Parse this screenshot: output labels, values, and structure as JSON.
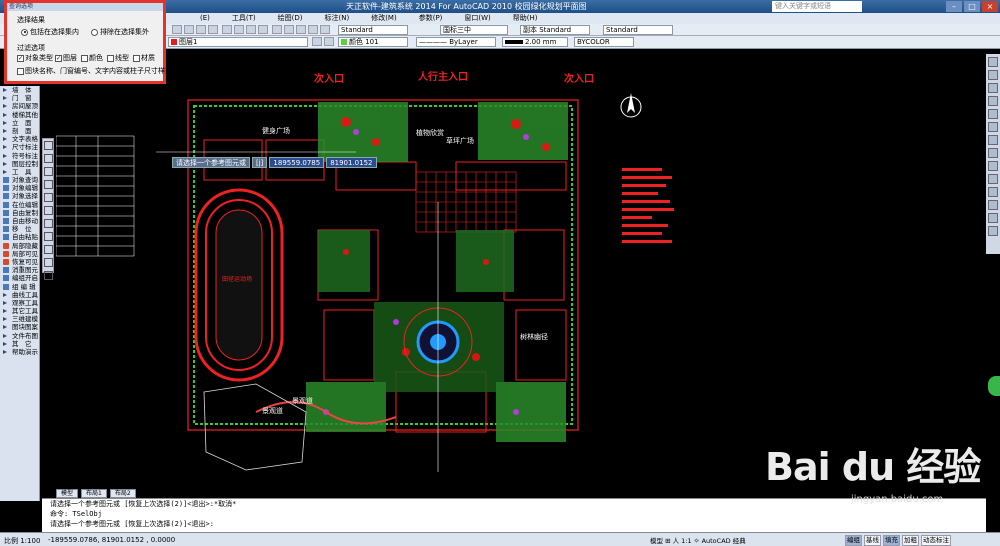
{
  "window": {
    "title": "天正软件-建筑系统 2014  For AutoCAD 2010      校园绿化规划平面图",
    "search_placeholder": "键入关键字或短语"
  },
  "menu": [
    "(E)",
    "工具(T)",
    "绘图(D)",
    "标注(N)",
    "修改(M)",
    "参数(P)",
    "窗口(W)",
    "帮助(H)"
  ],
  "toolbar": {
    "style1": "Standard",
    "style2": "国标三中",
    "style3": "副本 Standard",
    "style4": "Standard",
    "layer": "图层1",
    "color": "颜色 101",
    "linetype": "ByLayer",
    "lineweight": "2.00 mm",
    "plotstyle": "BYCOLOR"
  },
  "dialog": {
    "title": "查询选项",
    "group1": "选择结果",
    "radio_in": "包括在选择集内",
    "radio_out": "排除在选择集外",
    "group2": "过滤选项",
    "cb_objtype": "对象类型",
    "cb_layer": "图层",
    "cb_color": "颜色",
    "cb_linetype": "线型",
    "cb_material": "材质",
    "cb_block": "图块名称、门窗编号、文字内容或柱子尺寸样式"
  },
  "left_panel": [
    "墙　体",
    "门　窗",
    "房间屋顶",
    "楼梯其他",
    "立　面",
    "剖　面",
    "文字表格",
    "尺寸标注",
    "符号标注",
    "图层控制",
    "工　具",
    "对象查询",
    "对象编辑",
    "对象选择",
    "在位编辑",
    "自由复制",
    "自由移动",
    "移　位",
    "自由粘贴",
    "局部隐藏",
    "局部可见",
    "恢复可见",
    "消重图元",
    "编组开启",
    "组 编 辑",
    "曲线工具",
    "观察工具",
    "其它工具",
    "三维建模",
    "图块图案",
    "文件布图",
    "其　它",
    "帮助演示"
  ],
  "prompt": {
    "text": "请选择一个参考图元或",
    "hint": "[j]",
    "x": "189559.0785",
    "y": "81901.0152"
  },
  "drawing": {
    "labels": {
      "north_entry": "次入口",
      "main_entry": "人行主入口",
      "west_entry": "次入口",
      "fitness": "健身广场",
      "plant": "植物欣赏",
      "plaza": "草坪广场",
      "track": "田径运动场",
      "landscape": "景观道",
      "forest": "树林幽径",
      "scenic": "景观道"
    }
  },
  "command": {
    "line1": "请选择一个参考图元或 [恢复上次选择(2)]<退出>:*取消*",
    "line2": "命令: TSelObj",
    "line3": "请选择一个参考图元或 [恢复上次选择(2)]<退出>:"
  },
  "tabs": [
    "模型",
    "布局1",
    "布局2"
  ],
  "status": {
    "scale": "比例 1:100",
    "coords": "-189559.0786, 81901.0152 , 0.0000",
    "modes": [
      "编组",
      "基线",
      "填充",
      "加粗",
      "动态标注"
    ],
    "mid": "模型  ⊞  人 1:1  ☼  AutoCAD 经典"
  },
  "watermark": {
    "brand": "Bai du 经验",
    "url": "jingyan.baidu.com"
  }
}
